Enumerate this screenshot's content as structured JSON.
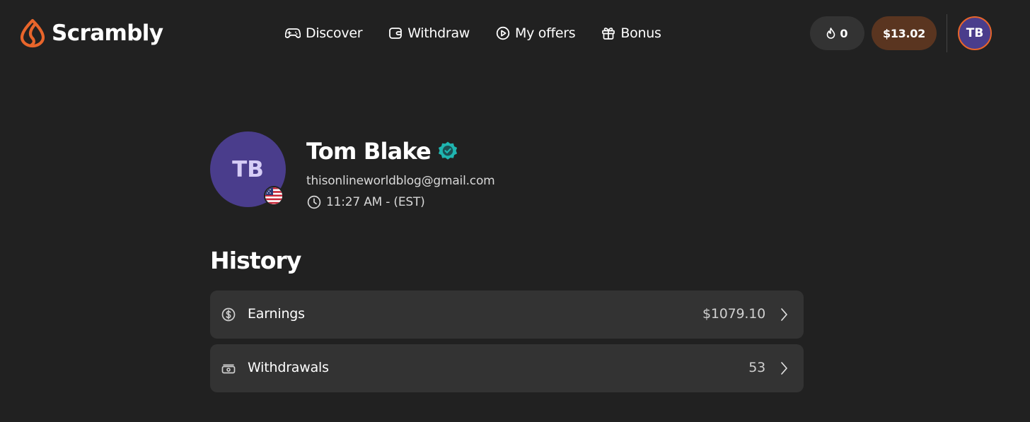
{
  "app": {
    "name": "Scrambly",
    "colors": {
      "background": "#212121",
      "surface": "#333333",
      "accent": "#e8652b",
      "avatar": "#4a3d8c",
      "verified": "#1fb5b0",
      "balance_pill": "#5a3520"
    }
  },
  "header": {
    "logo_icon": "scrambly-logo-icon",
    "nav": [
      {
        "label": "Discover",
        "icon": "gamepad-icon"
      },
      {
        "label": "Withdraw",
        "icon": "wallet-icon"
      },
      {
        "label": "My offers",
        "icon": "play-circle-icon"
      },
      {
        "label": "Bonus",
        "icon": "gift-icon"
      }
    ],
    "streak": {
      "icon": "flame-icon",
      "count": "0"
    },
    "balance": "$13.02",
    "avatar_initials": "TB"
  },
  "profile": {
    "initials": "TB",
    "flag_icon": "us-flag-icon",
    "name": "Tom Blake",
    "verified_icon": "verified-badge-icon",
    "email": "thisonlineworldblog@gmail.com",
    "time_icon": "clock-icon",
    "local_time": "11:27 AM - (EST)"
  },
  "history": {
    "heading": "History",
    "rows": [
      {
        "label": "Earnings",
        "value": "$1079.10",
        "icon": "dollar-circle-icon"
      },
      {
        "label": "Withdrawals",
        "value": "53",
        "icon": "cash-icon"
      }
    ]
  }
}
